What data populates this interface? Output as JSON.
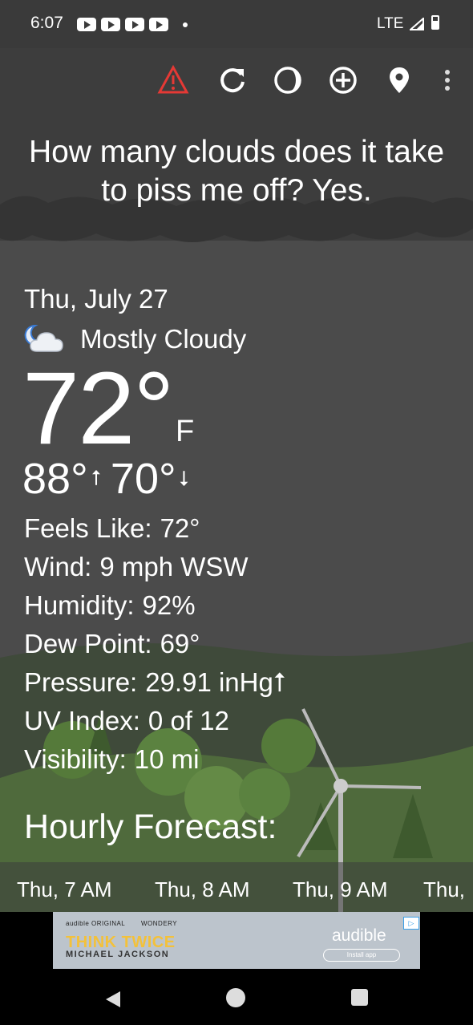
{
  "status_bar": {
    "time": "6:07",
    "network": "LTE"
  },
  "headline": "How many clouds does it take to piss me off? Yes.",
  "current": {
    "date": "Thu, July 27",
    "condition": "Mostly Cloudy",
    "condition_icon": "partly-cloudy-night-icon",
    "temperature": "72°",
    "unit": "F",
    "high": "88°",
    "low": "70°",
    "up_arrow": "⭡",
    "down_arrow": "⭣"
  },
  "details": [
    {
      "label": "Feels Like:",
      "value": "72°"
    },
    {
      "label": "Wind:",
      "value": "9 mph WSW"
    },
    {
      "label": "Humidity:",
      "value": "92%"
    },
    {
      "label": "Dew Point:",
      "value": "69°"
    },
    {
      "label": "Pressure:",
      "value": "29.91 inHg⭡"
    },
    {
      "label": "UV Index:",
      "value": "0 of 12"
    },
    {
      "label": "Visibility:",
      "value": "10 mi"
    }
  ],
  "hourly": {
    "title": "Hourly Forecast:",
    "items": [
      "Thu, 7 AM",
      "Thu, 8 AM",
      "Thu, 9 AM",
      "Thu,"
    ]
  },
  "ad": {
    "top_line_1": "audible ORIGINAL",
    "top_line_2": "WONDERY",
    "title": "THINK TWICE",
    "subtitle": "MICHAEL JACKSON",
    "brand": "audible",
    "cta": "Install app",
    "adchoices": "▷"
  },
  "colors": {
    "alert": "#e53935",
    "background": "#4b4b4b",
    "text": "#ffffff"
  }
}
